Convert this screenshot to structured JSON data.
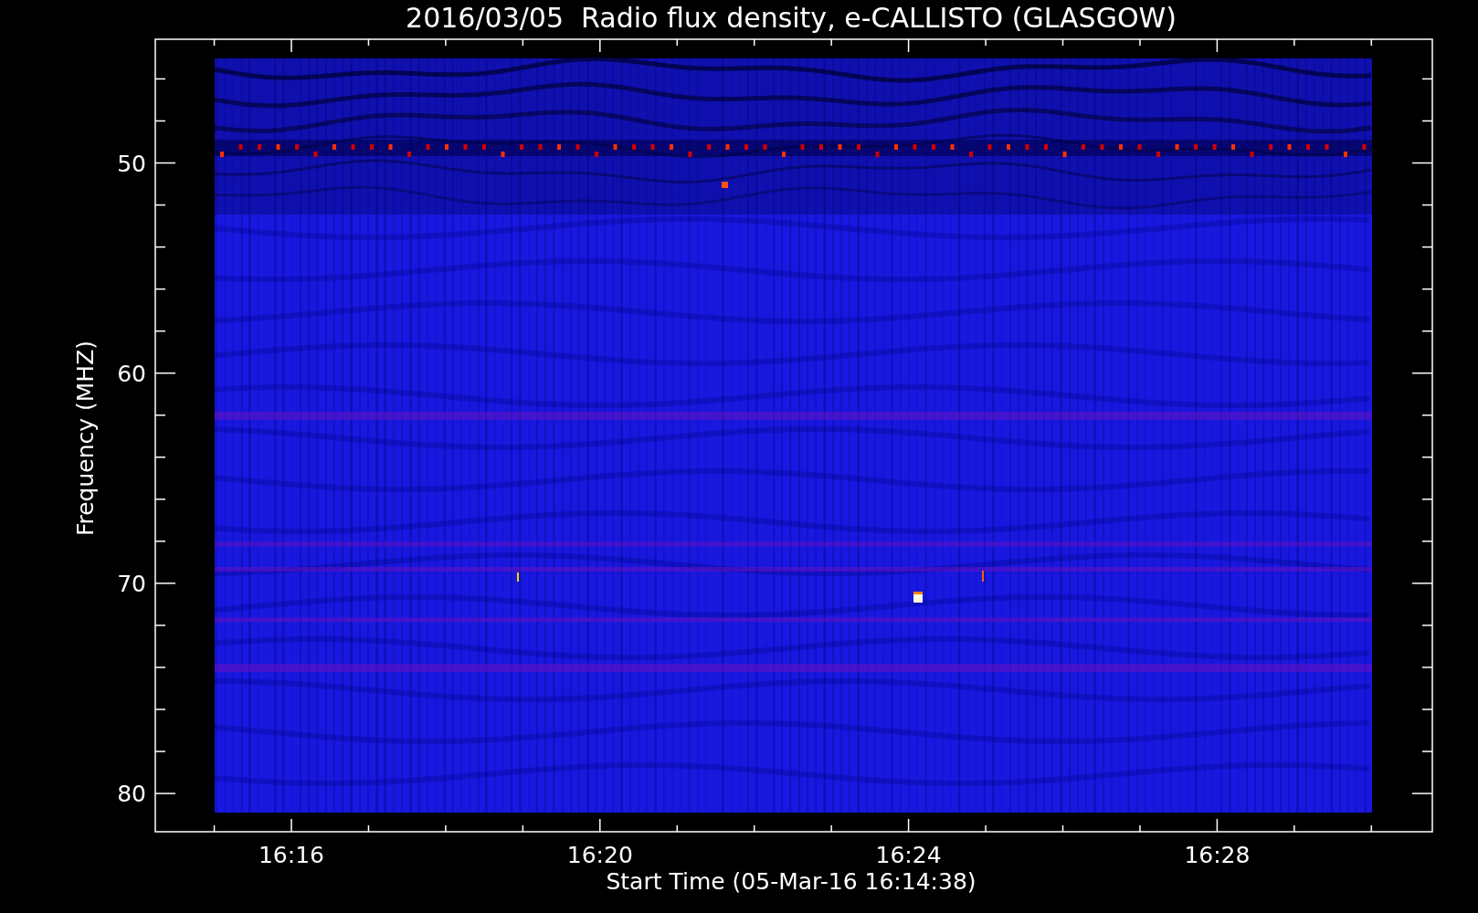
{
  "title": "2016/03/05  Radio flux density, e-CALLISTO (GLASGOW)",
  "y_axis": {
    "label": "Frequency (MHZ)",
    "ticks": [
      "50",
      "60",
      "70",
      "80"
    ]
  },
  "x_axis": {
    "label": "Start Time (05-Mar-16 16:14:38)",
    "ticks": [
      "16:16",
      "16:20",
      "16:24",
      "16:28"
    ]
  }
}
